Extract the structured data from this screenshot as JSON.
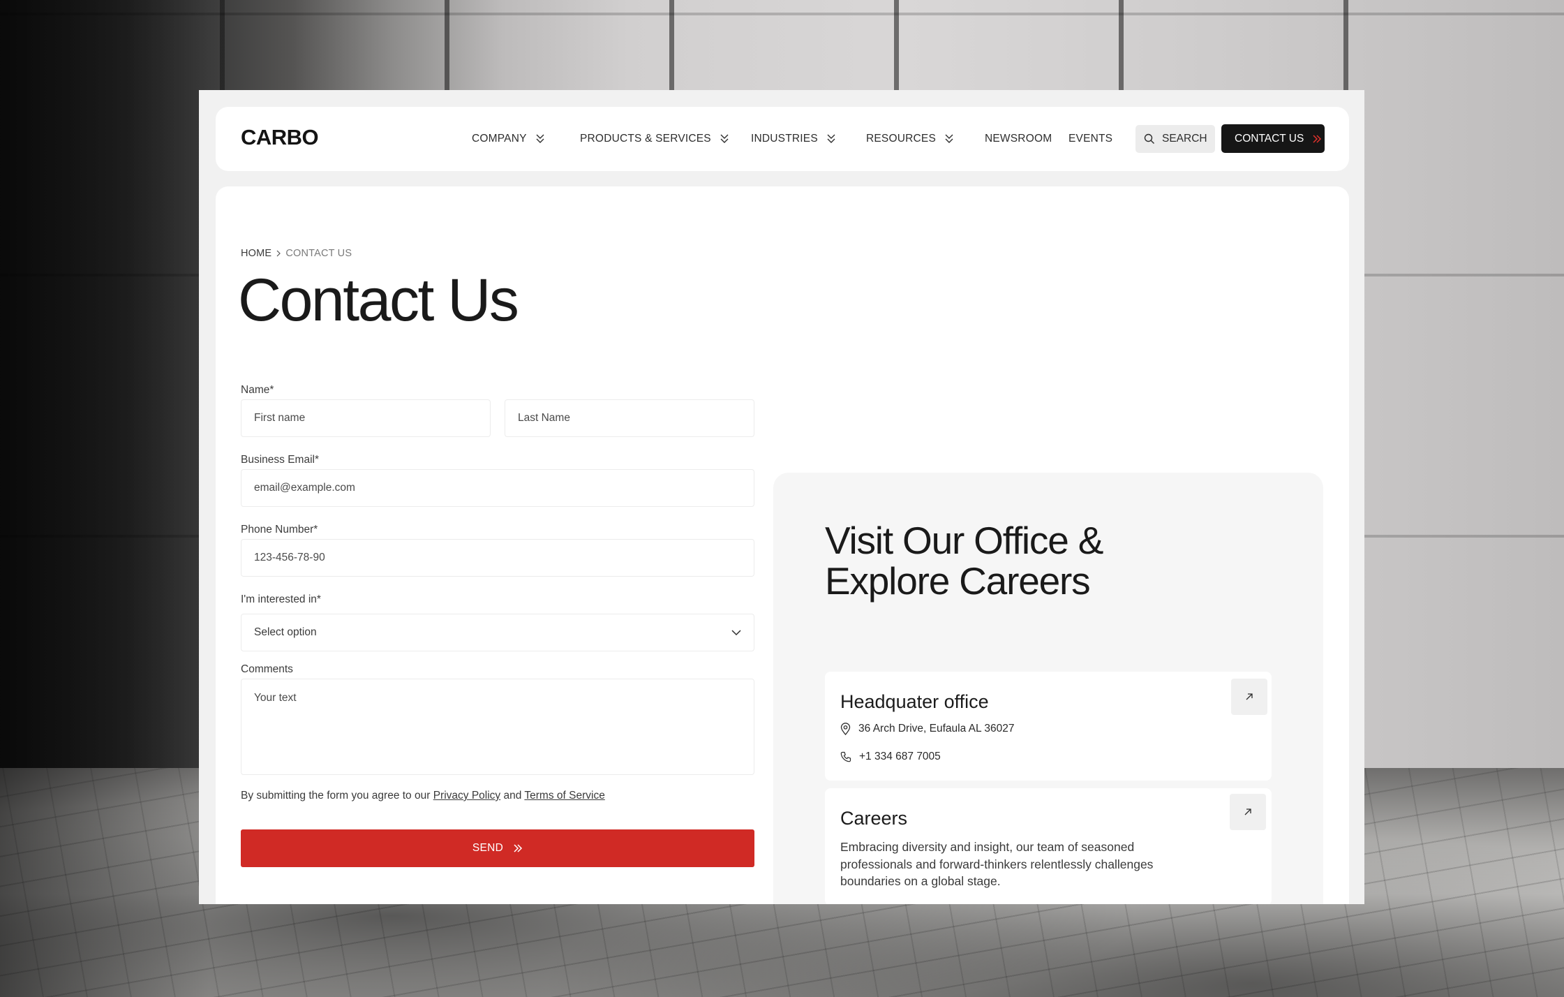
{
  "brand": {
    "logo": "CARBO",
    "accent_color": "#d02a25",
    "dark_color": "#161616"
  },
  "nav": {
    "items": [
      {
        "label": "COMPANY",
        "has_dropdown": true
      },
      {
        "label": "PRODUCTS & SERVICES",
        "has_dropdown": true
      },
      {
        "label": "INDUSTRIES",
        "has_dropdown": true
      },
      {
        "label": "RESOURCES",
        "has_dropdown": true
      },
      {
        "label": "NEWSROOM",
        "has_dropdown": false
      },
      {
        "label": "EVENTS",
        "has_dropdown": false
      }
    ],
    "search_label": "SEARCH",
    "contact_label": "CONTACT US"
  },
  "breadcrumb": {
    "home": "HOME",
    "current": "CONTACT US"
  },
  "page": {
    "title": "Contact Us"
  },
  "form": {
    "name_label": "Name*",
    "first_name_placeholder": "First name",
    "last_name_placeholder": "Last Name",
    "email_label": "Business Email*",
    "email_placeholder": "email@example.com",
    "phone_label": "Phone Number*",
    "phone_placeholder": "123-456-78-90",
    "interest_label": "I'm interested in*",
    "interest_selected": "Select option",
    "comments_label": "Comments",
    "comments_placeholder": "Your text",
    "consent_prefix": "By submitting the form you agree to our",
    "privacy_link": "Privacy Policy",
    "consent_and": "and",
    "terms_link": "Terms of Service",
    "send_label": "SEND"
  },
  "panel": {
    "title_line1": "Visit Our Office &",
    "title_line2": "Explore Careers",
    "hq": {
      "title": "Headquater office",
      "address": "36 Arch Drive, Eufaula AL 36027",
      "phone": "+1 334 687 7005"
    },
    "careers": {
      "title": "Careers",
      "description": "Embracing diversity and insight, our team of seasoned professionals and forward-thinkers relentlessly challenges boundaries on a global stage."
    }
  }
}
